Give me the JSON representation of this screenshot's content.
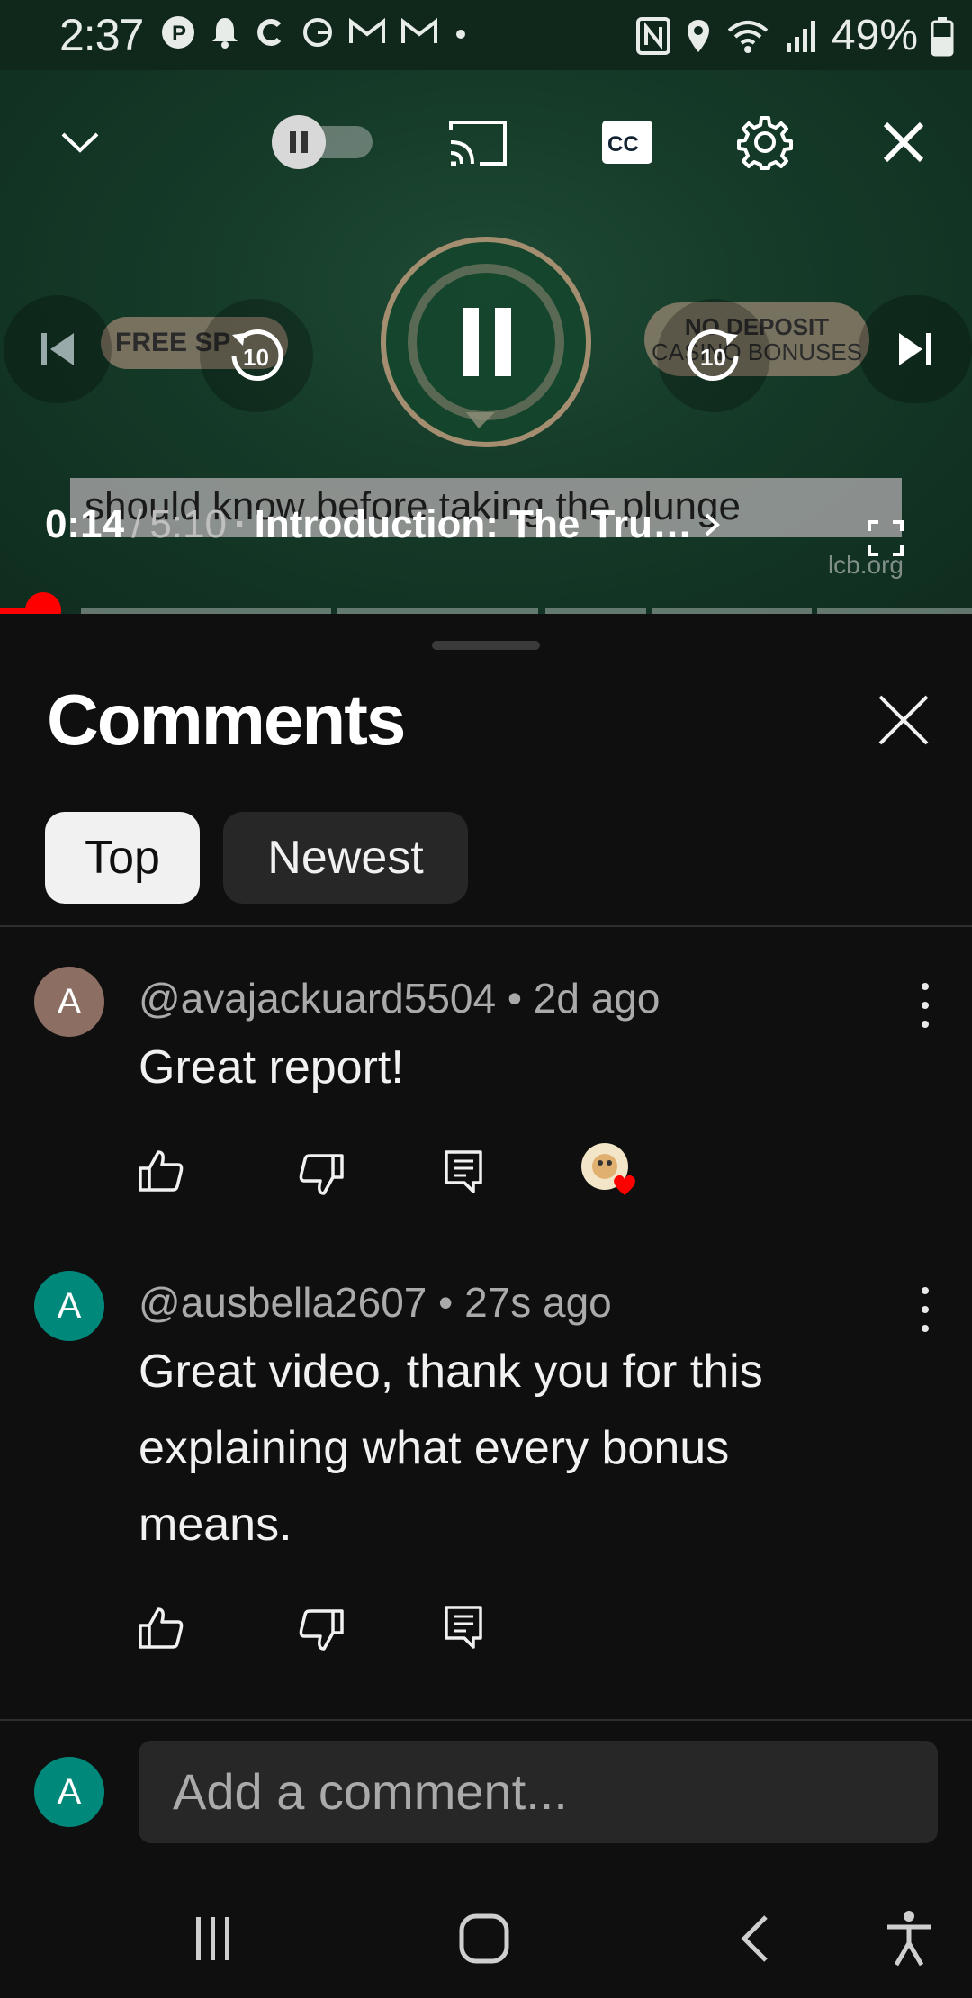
{
  "status_bar": {
    "time": "2:37",
    "battery": "49%"
  },
  "player": {
    "caption": "should know before taking the plunge",
    "current_time": "0:14",
    "duration": "5:10",
    "separator": "/",
    "chapter": "Introduction: The Tru…",
    "watermark": "lcb.org",
    "pill_left": "FREE SP",
    "pill_right_top": "NO DEPOSIT",
    "pill_right_bottom": "CASINO BONUSES",
    "skip_seconds": "10",
    "progress_fraction": 0.045
  },
  "comments": {
    "title": "Comments",
    "tabs": [
      "Top",
      "Newest"
    ],
    "items": [
      {
        "avatar": "A",
        "avatar_color": "#8d6e63",
        "author": "@avajackuard5504",
        "age": "2d ago",
        "text": "Great report!",
        "creator_heart": true
      },
      {
        "avatar": "A",
        "avatar_color": "#00897b",
        "author": "@ausbella2607",
        "age": "27s ago",
        "text": "Great video, thank you for this explaining what every bonus means.",
        "creator_heart": false
      }
    ],
    "add_avatar": "A",
    "add_placeholder": "Add a comment..."
  },
  "colors": {
    "accent_red": "#ff0000",
    "background": "#0f0f0f"
  }
}
